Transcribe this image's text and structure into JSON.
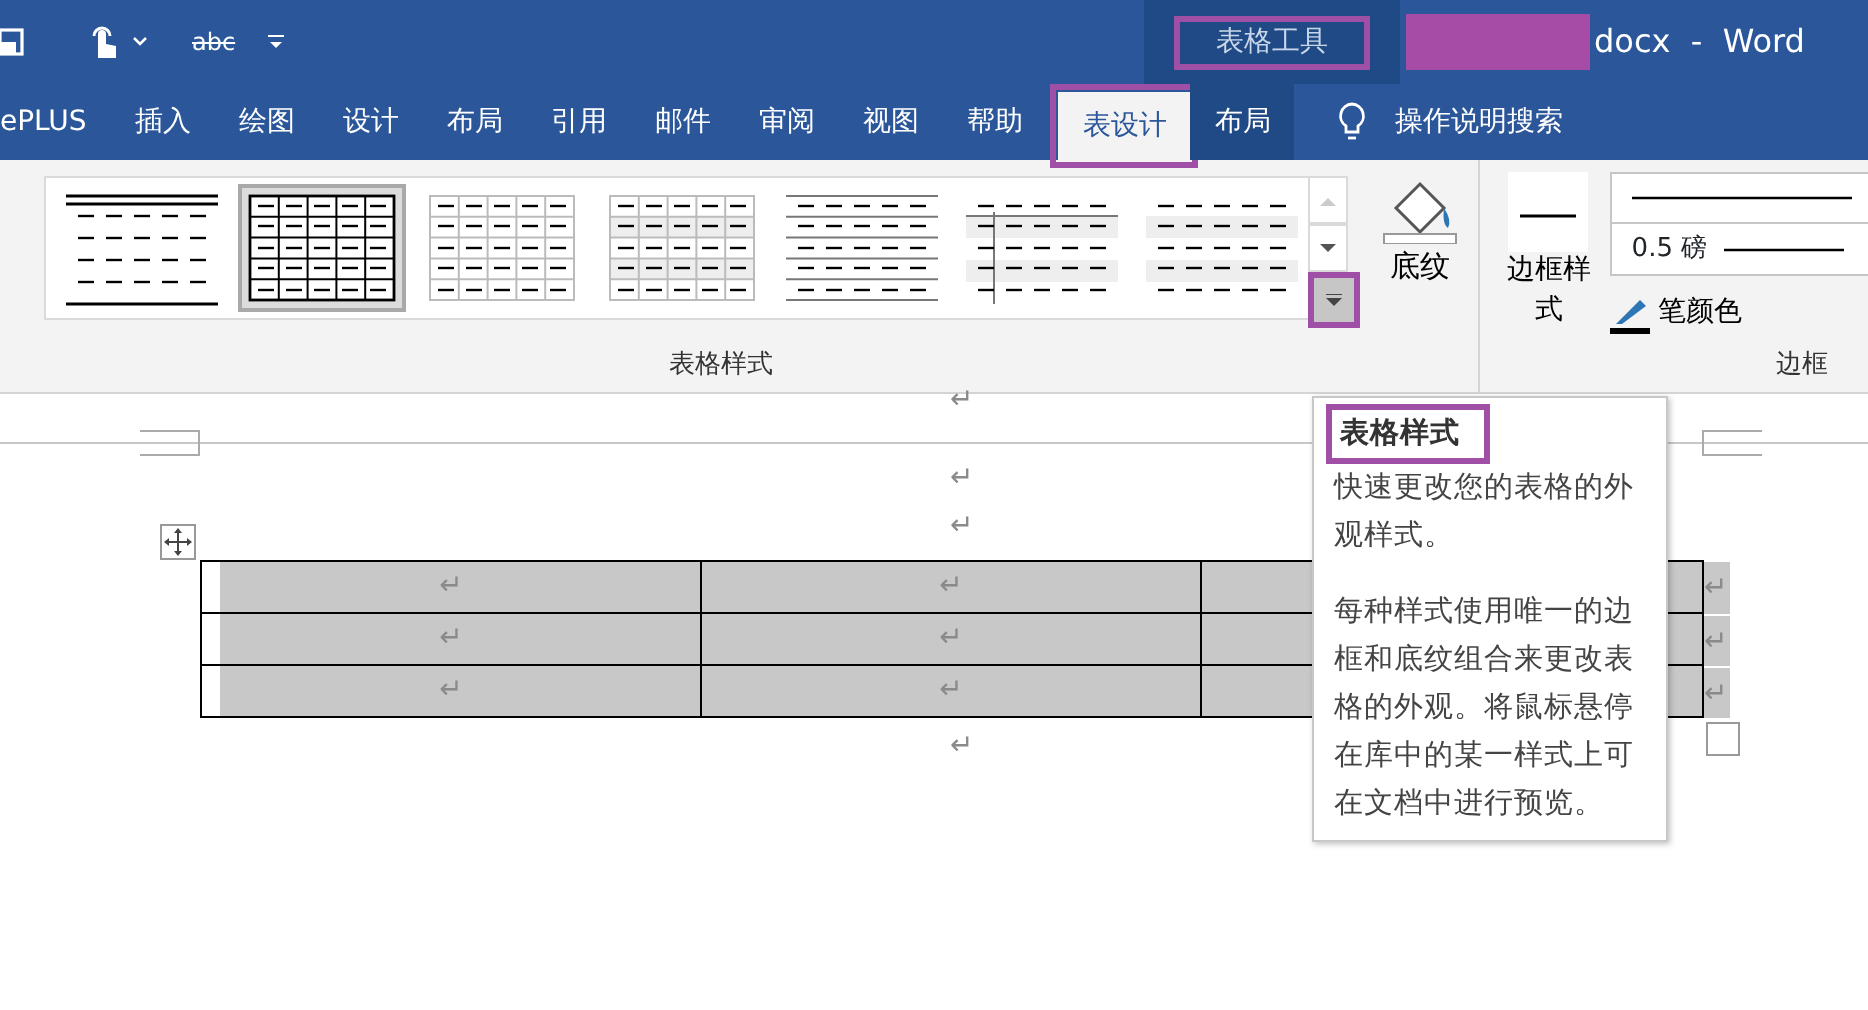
{
  "quick_access": {
    "strike_label": "abc"
  },
  "title_bar": {
    "context_label": "表格工具",
    "context_highlighted": true,
    "name_redacted": true,
    "title": "docx  -  Word"
  },
  "tabs": [
    {
      "label": "ePLUS",
      "selected": false,
      "kind": "main",
      "highlighted": false
    },
    {
      "label": "插入",
      "selected": false,
      "kind": "main",
      "highlighted": false
    },
    {
      "label": "绘图",
      "selected": false,
      "kind": "main",
      "highlighted": false
    },
    {
      "label": "设计",
      "selected": false,
      "kind": "main",
      "highlighted": false
    },
    {
      "label": "布局",
      "selected": false,
      "kind": "main",
      "highlighted": false
    },
    {
      "label": "引用",
      "selected": false,
      "kind": "main",
      "highlighted": false
    },
    {
      "label": "邮件",
      "selected": false,
      "kind": "main",
      "highlighted": false
    },
    {
      "label": "审阅",
      "selected": false,
      "kind": "main",
      "highlighted": false
    },
    {
      "label": "视图",
      "selected": false,
      "kind": "main",
      "highlighted": false
    },
    {
      "label": "帮助",
      "selected": false,
      "kind": "main",
      "highlighted": false
    },
    {
      "label": "表设计",
      "selected": true,
      "kind": "context",
      "highlighted": true
    },
    {
      "label": "布局",
      "selected": false,
      "kind": "context",
      "highlighted": false
    }
  ],
  "tell_me": {
    "label": "操作说明搜索"
  },
  "ribbon": {
    "styles_group": {
      "label": "表格样式",
      "more_highlighted": true,
      "shading_label": "底纹",
      "styles": [
        {
          "kind": "horizontal",
          "selected": false
        },
        {
          "kind": "grid",
          "selected": true
        },
        {
          "kind": "light-grid",
          "selected": false
        },
        {
          "kind": "banded-grid",
          "selected": false
        },
        {
          "kind": "lines",
          "selected": false
        },
        {
          "kind": "first-column",
          "selected": false
        },
        {
          "kind": "banded",
          "selected": false
        }
      ]
    },
    "borders_group": {
      "label": "边框",
      "border_styles_label": "边框样式",
      "weight": "0.5 磅",
      "pen_color_label": "笔颜色"
    }
  },
  "document": {
    "marks_before": [
      "↵",
      "↵",
      "↵"
    ],
    "table": {
      "rows": [
        {
          "cells": [
            "↵",
            "↵"
          ],
          "end_mark": "↵"
        },
        {
          "cells": [
            "↵",
            "↵"
          ],
          "end_mark": "↵"
        },
        {
          "cells": [
            "↵",
            "↵"
          ],
          "end_mark": "↵"
        }
      ]
    },
    "marks_after": [
      "↵"
    ]
  },
  "tooltip": {
    "title": "表格样式",
    "title_highlighted": true,
    "paragraphs": [
      "快速更改您的表格的外观样式。",
      "每种样式使用唯一的边框和底纹组合来更改表格的外观。将鼠标悬停在库中的某一样式上可在文档中进行预览。"
    ]
  }
}
